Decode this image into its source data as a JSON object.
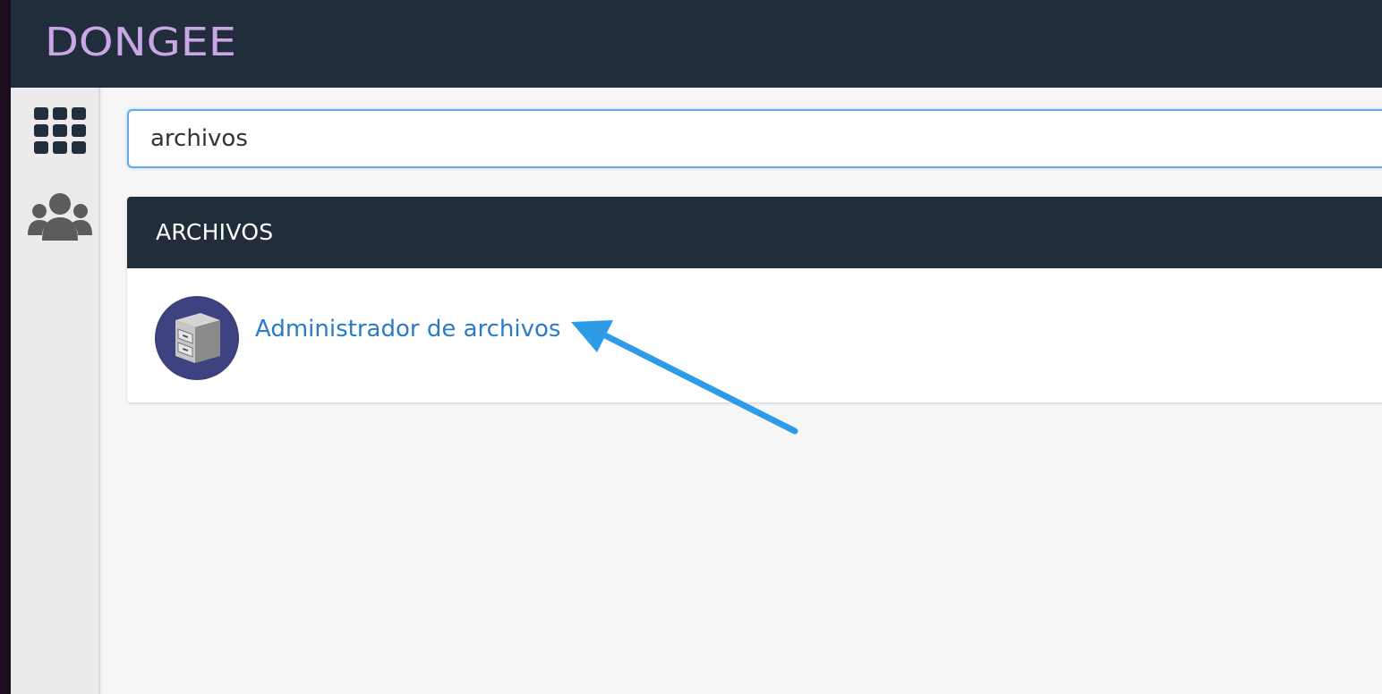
{
  "brand": {
    "logo_text": "DONGEE",
    "logo_color": "#c9a6e6"
  },
  "sidebar": {
    "items": [
      {
        "name": "grid-icon"
      },
      {
        "name": "users-icon"
      }
    ]
  },
  "search": {
    "value": "archivos"
  },
  "results": {
    "section_title": "ARCHIVOS",
    "items": [
      {
        "label": "Administrador de archivos",
        "icon": "file-cabinet-icon"
      }
    ]
  },
  "annotation": {
    "arrow_icon": "arrow-icon",
    "arrow_color": "#2d9be8"
  },
  "colors": {
    "topbar": "#222d3b",
    "link": "#2a7cc7",
    "focus_border": "#67a9ea",
    "background": "#f6f6f6"
  }
}
